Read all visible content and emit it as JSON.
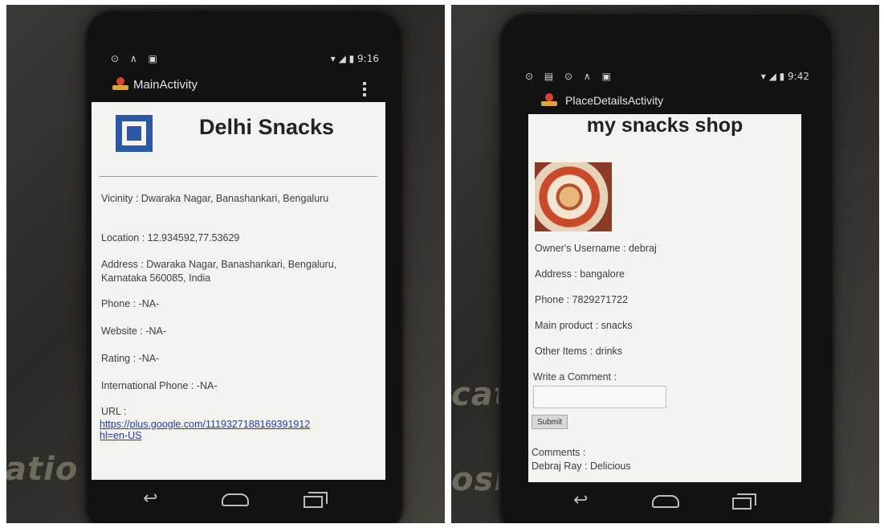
{
  "left": {
    "status": {
      "icons": "⊙ ∧ ▣",
      "right": "▾ ◢ ▮ 9:16"
    },
    "actionbar": {
      "title": "MainActivity"
    },
    "place": {
      "name": "Delhi Snacks",
      "vicinity": "Vicinity : Dwaraka Nagar, Banashankari, Bengaluru",
      "location": "Location : 12.934592,77.53629",
      "address": "Address : Dwaraka Nagar, Banashankari, Bengaluru, Karnataka 560085, India",
      "phone": "Phone : -NA-",
      "website": "Website : -NA-",
      "rating": "Rating : -NA-",
      "intl_phone": "International Phone : -NA-",
      "url_label": "URL :",
      "url_line1": "https://plus.google.com/1119327188169391912",
      "url_line2": "hl=en-US"
    },
    "background_text": "atio"
  },
  "right": {
    "status": {
      "icons": "⊙ ▤ ⊙ ∧ ▣",
      "right": "▾ ◢ ▮ 9:42"
    },
    "actionbar": {
      "title": "PlaceDetailsActivity"
    },
    "shop": {
      "name": "my snacks shop",
      "owner": "Owner's Username : debraj",
      "address": "Address : bangalore",
      "phone": "Phone : 7829271722",
      "main_product": "Main product : snacks",
      "other_items": "Other Items : drinks",
      "comment_label": "Write a Comment :",
      "comment_value": "",
      "submit_label": "Submit",
      "comments_heading": "Comments :",
      "comment_entry": "Debraj Ray : Delicious"
    },
    "background_text_1": "cati",
    "background_text_2": "osi"
  }
}
